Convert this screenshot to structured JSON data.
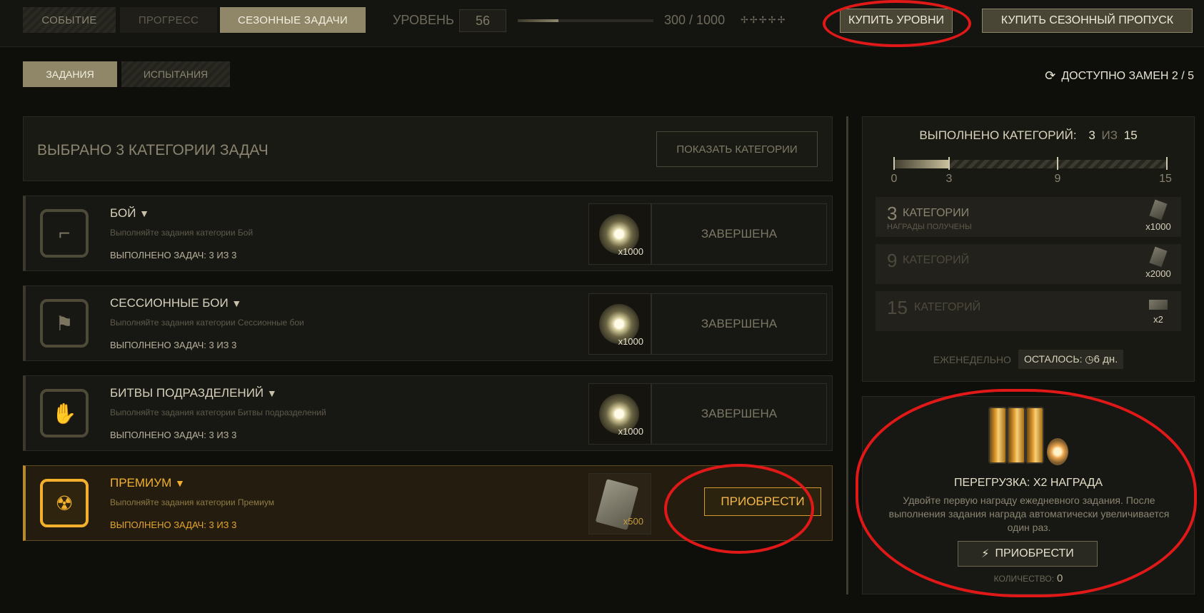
{
  "topbar": {
    "tabs": [
      {
        "label": "СОБЫТИЕ"
      },
      {
        "label": "ПРОГРЕСС"
      },
      {
        "label": "СЕЗОННЫЕ ЗАДАЧИ"
      }
    ],
    "level_label": "УРОВЕНЬ",
    "level_value": "56",
    "xp_text": "300 / 1000",
    "xp_fraction": 0.3,
    "stars": "✢✢✢✢✢",
    "buy_levels": "КУПИТЬ УРОВНИ",
    "buy_pass": "КУПИТЬ СЕЗОННЫЙ ПРОПУСК"
  },
  "subtabs": [
    {
      "label": "ЗАДАНИЯ"
    },
    {
      "label": "ИСПЫТАНИЯ"
    }
  ],
  "replacements": {
    "icon": "refresh-icon",
    "text": "ДОСТУПНО ЗАМЕН 2 / 5"
  },
  "categories_header": {
    "title": "ВЫБРАНО 3 КАТЕГОРИИ ЗАДАЧ",
    "show_button": "ПОКАЗАТЬ КАТЕГОРИИ"
  },
  "rows": [
    {
      "name": "БОЙ",
      "desc": "Выполняйте задания категории Бой",
      "progress": "ВЫПОЛНЕНО ЗАДАЧ: 3 ИЗ 3",
      "reward_qty": "x1000",
      "status": "ЗАВЕРШЕНА",
      "icon": "pistols-icon"
    },
    {
      "name": "СЕССИОННЫЕ БОИ",
      "desc": "Выполняйте задания категории Сессионные бои",
      "progress": "ВЫПОЛНЕНО ЗАДАЧ: 3 ИЗ 3",
      "reward_qty": "x1000",
      "status": "ЗАВЕРШЕНА",
      "icon": "flag-icon"
    },
    {
      "name": "БИТВЫ ПОДРАЗДЕЛЕНИЙ",
      "desc": "Выполняйте задания категории Битвы подразделений",
      "progress": "ВЫПОЛНЕНО ЗАДАЧ: 3 ИЗ 3",
      "reward_qty": "x1000",
      "status": "ЗАВЕРШЕНА",
      "icon": "squad-icon"
    },
    {
      "name": "ПРЕМИУМ",
      "desc": "Выполняйте задания категории Премиум",
      "progress": "ВЫПОЛНЕНО ЗАДАЧ: 3 ИЗ 3",
      "reward_qty": "x500",
      "action": "ПРИОБРЕСТИ",
      "icon": "radiation-icon"
    }
  ],
  "right_panel": {
    "head_label": "ВЫПОЛНЕНО КАТЕГОРИЙ:",
    "done": "3",
    "of": "ИЗ",
    "total": "15",
    "progress_fraction": 0.2,
    "ticks": [
      "0",
      "3",
      "9",
      "15"
    ],
    "milestones": [
      {
        "n": "3",
        "label": "КАТЕГОРИИ",
        "sub": "НАГРАДЫ ПОЛУЧЕНЫ",
        "qty": "x1000"
      },
      {
        "n": "9",
        "label": "КАТЕГОРИЙ",
        "sub": "",
        "qty": "x2000"
      },
      {
        "n": "15",
        "label": "КАТЕГОРИЙ",
        "sub": "",
        "qty": "x2"
      }
    ],
    "weekly": "ЕЖЕНЕДЕЛЬНО",
    "remaining_label": "ОСТАЛОСЬ:",
    "remaining_value": "6 дн."
  },
  "boost": {
    "title": "ПЕРЕГРУЗКА: X2 НАГРАДА",
    "desc": "Удвойте первую награду ежедневного задания. После выполнения задания награда автоматически увеличивается один раз.",
    "buy": "ПРИОБРЕСТИ",
    "count_label": "КОЛИЧЕСТВО:",
    "count_value": "0"
  }
}
